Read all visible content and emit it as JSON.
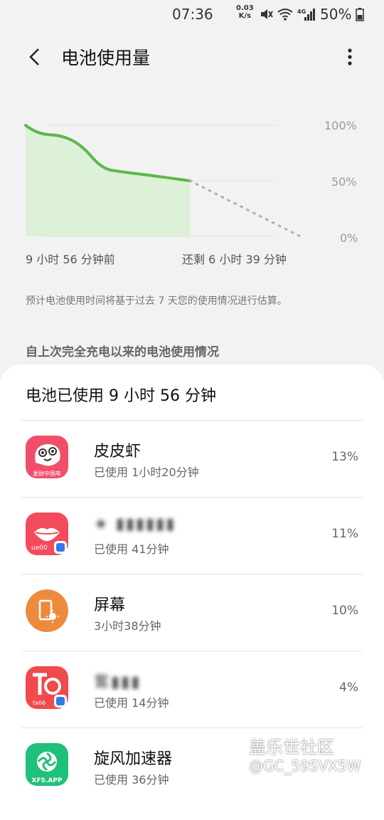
{
  "status_bar": {
    "time": "07:36",
    "net_speed_value": "0.03",
    "net_speed_unit": "K/s",
    "network_badge": "4G",
    "battery_percent": "50%"
  },
  "header": {
    "title": "电池使用量"
  },
  "chart_data": {
    "type": "area",
    "ylim": [
      0,
      100
    ],
    "y_ticks": [
      "100%",
      "50%",
      "0%"
    ],
    "x_start_label": "9 小时 56 分钟前",
    "x_end_label": "还剩 6 小时 39 分钟",
    "series": [
      {
        "values": [
          [
            0,
            100
          ],
          [
            0.7,
            92
          ],
          [
            2.2,
            91
          ],
          [
            3.4,
            82
          ],
          [
            4.6,
            61
          ],
          [
            5.8,
            58
          ],
          [
            7.0,
            56
          ],
          [
            9.93,
            50
          ]
        ]
      },
      {
        "values": [
          [
            9.93,
            50
          ],
          [
            16.58,
            0
          ]
        ],
        "style": "dotted"
      }
    ],
    "colors": {
      "fill": "#d9f0d3",
      "line": "#5bb84a",
      "projection": "#b0b0b0"
    }
  },
  "note": "预计电池使用时间将基于过去 7 天您的使用情况进行估算。",
  "section": {
    "title": "自上次完全充电以来的电池使用情况"
  },
  "usage_card": {
    "title": "电池已使用 9 小时 56 分钟",
    "apps": [
      {
        "name": "皮皮虾",
        "usage": "已使用 1小时20分钟",
        "percent": "13%",
        "icon_label": "发财中国年"
      },
      {
        "name": "★ ▮▮▮▮▮▮",
        "usage": "已使用 41分钟",
        "percent": "11%",
        "icon_label": "ue00"
      },
      {
        "name": "屏幕",
        "usage": "3小时38分钟",
        "percent": "10%",
        "icon_label": ""
      },
      {
        "name": "奮▮▮▮",
        "usage": "已使用 14分钟",
        "percent": "4%",
        "icon_label": "ta66"
      },
      {
        "name": "旋风加速器",
        "usage": "已使用 36分钟",
        "percent": "",
        "icon_label": "XFS.APP"
      }
    ]
  },
  "watermark": {
    "brand": "盖乐世社区",
    "user": "@GC_59SVX5W"
  }
}
